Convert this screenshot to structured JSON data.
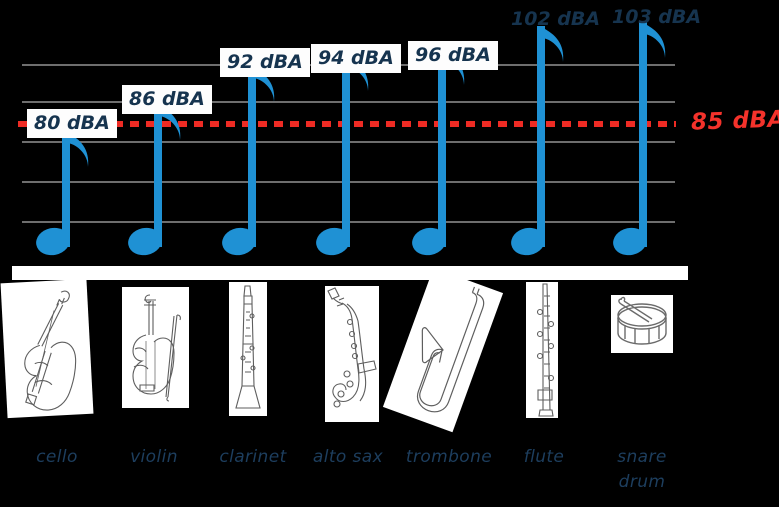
{
  "chart_data": {
    "type": "bar",
    "title": "",
    "xlabel": "",
    "ylabel": "",
    "units": "dBA",
    "grid": true,
    "legend": "none",
    "categories": [
      "cello",
      "violin",
      "clarinet",
      "alto sax",
      "trombone",
      "flute",
      "snare drum"
    ],
    "values": [
      80,
      86,
      92,
      94,
      96,
      102,
      103
    ],
    "value_labels": [
      "80 dBA",
      "86 dBA",
      "92 dBA",
      "94 dBA",
      "96 dBA",
      "102 dBA",
      "103 dBA"
    ],
    "threshold": {
      "value": 85,
      "label": "85 dBA",
      "style": "dotted",
      "color": "#f4322b"
    },
    "marker_style": "eighth-note",
    "series_color": "#1f91d4",
    "gridline_color": "#6e6e6e",
    "label_text_color": "#16344f",
    "background": "#000000"
  },
  "axis": {
    "gridline_count": 5
  },
  "instruments": [
    {
      "name": "cello",
      "label": "cello",
      "label2": "",
      "icon": "cello-icon",
      "value_label": "80 dBA"
    },
    {
      "name": "violin",
      "label": "violin",
      "label2": "",
      "icon": "violin-icon",
      "value_label": "86 dBA"
    },
    {
      "name": "clarinet",
      "label": "clarinet",
      "label2": "",
      "icon": "clarinet-icon",
      "value_label": "92 dBA"
    },
    {
      "name": "alto-sax",
      "label": "alto sax",
      "label2": "",
      "icon": "saxophone-icon",
      "value_label": "94 dBA"
    },
    {
      "name": "trombone",
      "label": "trombone",
      "label2": "",
      "icon": "trombone-icon",
      "value_label": "96 dBA"
    },
    {
      "name": "flute",
      "label": "flute",
      "label2": "",
      "icon": "flute-icon",
      "value_label": "102 dBA"
    },
    {
      "name": "snare-drum",
      "label": "snare",
      "label2": "drum",
      "icon": "snare-drum-icon",
      "value_label": "103 dBA"
    }
  ]
}
